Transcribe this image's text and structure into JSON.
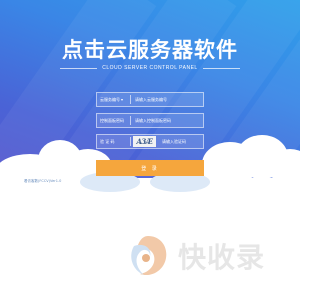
{
  "header": {
    "title": "点击云服务器软件",
    "subtitle": "CLOUD SERVER CONTROL PANEL"
  },
  "form": {
    "server_label": "云服务编号",
    "server_dropdown_icon": "chevron-down-icon",
    "server_placeholder": "请输入云服务编号",
    "password_label": "控制面板密码",
    "password_placeholder": "请输入控制面板密码",
    "captcha_label": "验 证 码",
    "captcha_image_text": "A3Æ",
    "captcha_placeholder": "请输入验证码",
    "login_label": "登 录"
  },
  "footer": {
    "corner_text": "看访客数(FCCV)Ver1.0"
  },
  "watermark": {
    "text": "快收录"
  },
  "colors": {
    "accent": "#f5a63d",
    "hero_top": "#2fa0ea",
    "hero_bottom": "#5a55cc"
  }
}
